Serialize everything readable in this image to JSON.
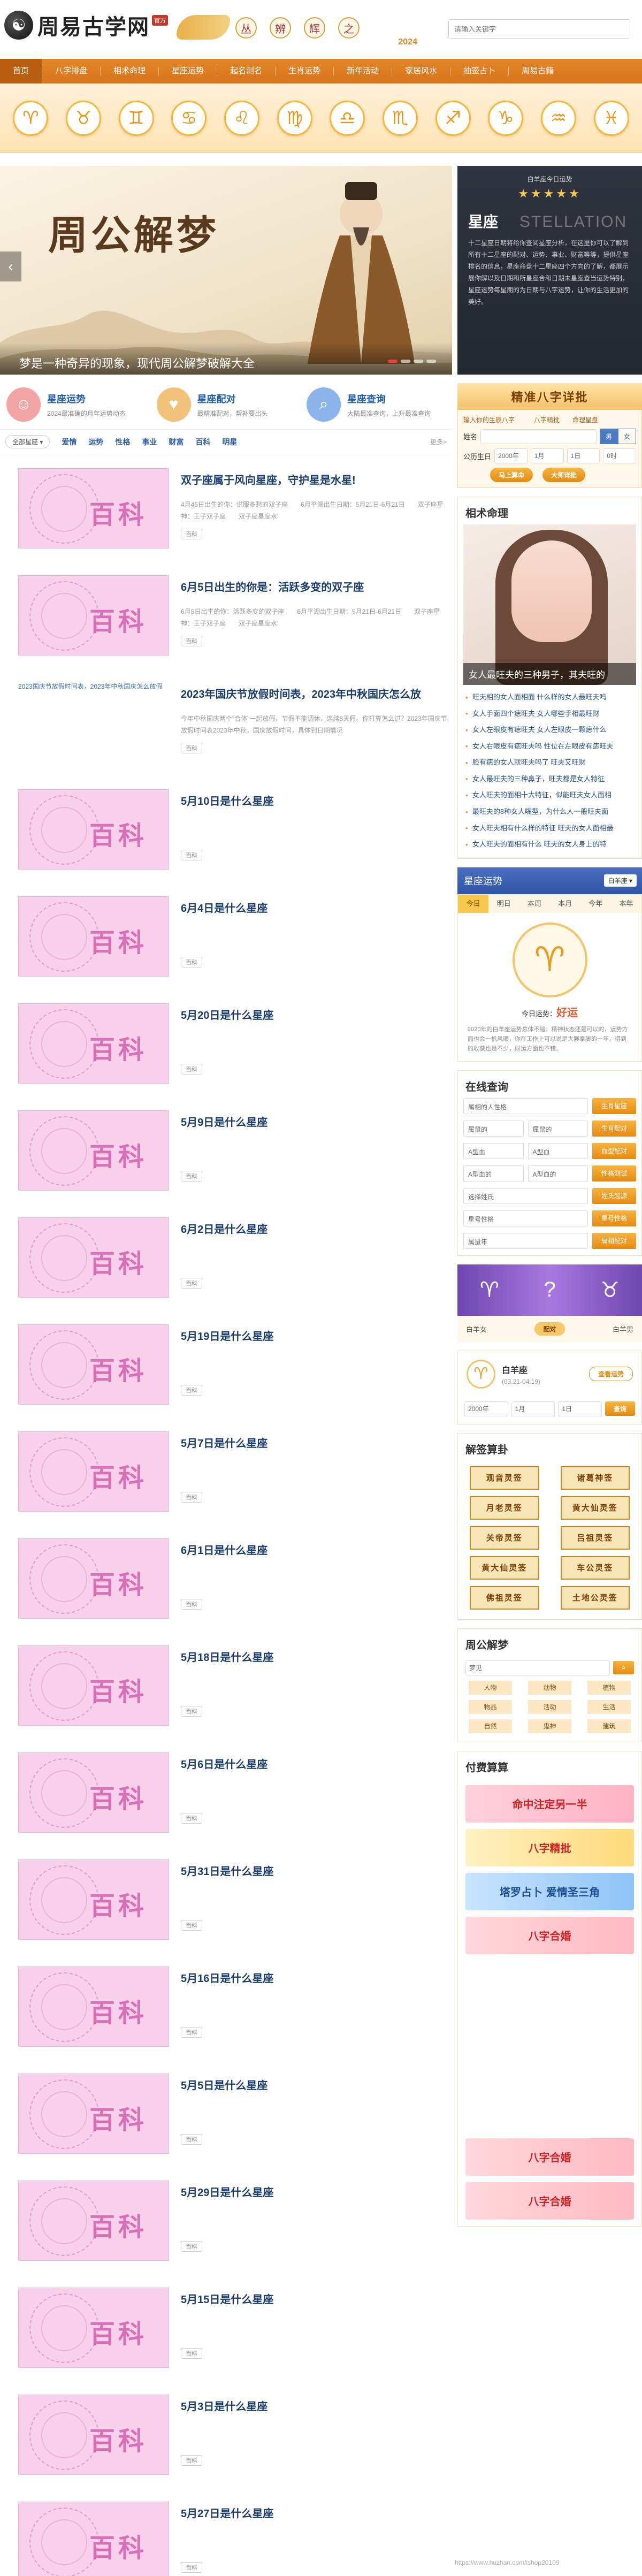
{
  "site": {
    "logo_glyph": "☯",
    "logo_text": "周易古学网",
    "logo_tag": "官方",
    "deco_chars": [
      "丛",
      "辨",
      "辉",
      "之"
    ],
    "deco_year": "2024",
    "search_placeholder": "请输入关键字"
  },
  "nav": {
    "items": [
      "首页",
      "八字排盘",
      "相术命理",
      "星座运势",
      "起名测名",
      "生肖运势",
      "新年活动",
      "家居风水",
      "抽签占卜",
      "周易古籍"
    ],
    "active_index": 0
  },
  "zodiac_icons": [
    "♈",
    "♉",
    "♊",
    "♋",
    "♌",
    "♍",
    "♎",
    "♏",
    "♐",
    "♑",
    "♒",
    "♓"
  ],
  "hero": {
    "title": "周公解梦",
    "caption": "梦是一种奇异的现象，现代周公解梦破解大全"
  },
  "quick": [
    {
      "icon": "star-person-icon",
      "title": "星座运势",
      "sub": "2024最准确的月年运势动态"
    },
    {
      "icon": "couple-icon",
      "title": "星座配对",
      "sub": "最精准配对，帮补要出头"
    },
    {
      "icon": "search-icon",
      "title": "星座查询",
      "sub": "大陆最准查询，上升最准查询"
    }
  ],
  "tabs": {
    "select_label": "全部星座",
    "items": [
      "爱情",
      "运势",
      "性格",
      "事业",
      "财富",
      "百科",
      "明星"
    ],
    "more": "更多>"
  },
  "articles": [
    {
      "title": "双子座属于风向星座，守护星是水星!",
      "desc": "4月45日出生的你：说服多愁的双子座　　6月平湖出生日期：5月21日-6月21日　　双子座星神：王子双子座　　双子座星座水",
      "tag": "百科",
      "image": "百科"
    },
    {
      "title": "6月5日出生的你是：活跃多变的双子座",
      "desc": "6月5日出生的你：活跃多变的双子座　　6月平湖出生日期：5月21日-6月21日　　双子座星神：王子双子座　　双子座星座水",
      "tag": "百科",
      "image": "百科"
    },
    {
      "title": "2023年国庆节放假时间表，2023年中秋国庆怎么放",
      "desc": "今年中秋国庆两个\"合体\"一起放假，节假不能调休，连续8天假。你打算怎么过？2023年国庆节放假时间表2023年中秋，国庆放假时间，具体到日期情况",
      "tag": "百科",
      "image_alt": "2023国庆节放假时间表，2023年中秋国庆怎么放假"
    },
    {
      "title": "5月10日是什么星座",
      "desc": "",
      "tag": "百科",
      "image": "百科"
    },
    {
      "title": "6月4日是什么星座",
      "desc": "",
      "tag": "百科",
      "image": "百科"
    },
    {
      "title": "5月20日是什么星座",
      "desc": "",
      "tag": "百科",
      "image": "百科"
    },
    {
      "title": "5月9日是什么星座",
      "desc": "",
      "tag": "百科",
      "image": "百科"
    },
    {
      "title": "6月2日是什么星座",
      "desc": "",
      "tag": "百科",
      "image": "百科"
    },
    {
      "title": "5月19日是什么星座",
      "desc": "",
      "tag": "百科",
      "image": "百科"
    },
    {
      "title": "5月7日是什么星座",
      "desc": "",
      "tag": "百科",
      "image": "百科"
    },
    {
      "title": "6月1日是什么星座",
      "desc": "",
      "tag": "百科",
      "image": "百科"
    },
    {
      "title": "5月18日是什么星座",
      "desc": "",
      "tag": "百科",
      "image": "百科"
    },
    {
      "title": "5月6日是什么星座",
      "desc": "",
      "tag": "百科",
      "image": "百科"
    },
    {
      "title": "5月31日是什么星座",
      "desc": "",
      "tag": "百科",
      "image": "百科"
    },
    {
      "title": "5月16日是什么星座",
      "desc": "",
      "tag": "百科",
      "image": "百科"
    },
    {
      "title": "5月5日是什么星座",
      "desc": "",
      "tag": "百科",
      "image": "百科"
    },
    {
      "title": "5月29日是什么星座",
      "desc": "",
      "tag": "百科",
      "image": "百科"
    },
    {
      "title": "5月15日是什么星座",
      "desc": "",
      "tag": "百科",
      "image": "百科"
    },
    {
      "title": "5月3日是什么星座",
      "desc": "",
      "tag": "百科",
      "image": "百科"
    },
    {
      "title": "5月27日是什么星座",
      "desc": "",
      "tag": "百科",
      "image": "百科"
    }
  ],
  "star_panel": {
    "head": "白羊座今日运势",
    "stars": "★★★★★",
    "title": "星座",
    "title_en": "STELLATION",
    "body": "十二星座日期将给你查阅星座分析，在这里你可以了解到所有十二星座的配对、运势、事业、财富等等，提供星座排名的信息，星座命盘十二星座四个方向的了解，都展示展你解以及日期和所星座合和日期未星座查当运势特别，星座运势每星期的为日期与八字运势，让你的生活更加的美好。"
  },
  "bazi": {
    "head": "精准八字详批",
    "sub": "输入你的生辰八字　　　八字精批　　命理星盘",
    "name_label": "姓名",
    "name_placeholder": "",
    "gender": [
      "男",
      "女"
    ],
    "gender_on": 0,
    "birth_label": "公历生日",
    "year": "2000年",
    "month": "1月",
    "day": "1日",
    "hour": "0时",
    "btn1": "马上算命",
    "btn2": "大师详批"
  },
  "fate": {
    "heading": "相术命理",
    "image_caption": "女人最旺夫的三种男子，其夫旺的",
    "items": [
      "旺夫相的女人面相面 什么样的女人最旺夫吗",
      "女人手面四个痣旺夫 女人哪些手相最旺财",
      "女人左眼皮有痣旺夫 女人左眼皮一颗痣什么",
      "女人右眼皮有痣旺夫吗 性位在左眼皮有痣旺夫",
      "脸有痣的女人就旺夫吗了 旺夫又旺财",
      "女人最旺夫的三种鼻子，旺夫都是女人特征",
      "女人旺夫的面相十大特征，似能旺夫女人面相",
      "最旺夫的8种女人嘴型，为什么人一般旺夫面",
      "女人旺夫相有什么样的特征 旺夫的女人面相最",
      "女人旺夫的面相有什么 旺夫的女人身上的特"
    ]
  },
  "fortune": {
    "head": "星座运势",
    "select": "白羊座",
    "tabs": [
      "今日",
      "明日",
      "本周",
      "本月",
      "今年",
      "本年"
    ],
    "tab_on": 0,
    "glyph": "♈",
    "luck_label": "今日运势：",
    "luck_value": "好运",
    "desc": "2020年的白羊座运势总体不错，精神状态还是可以的，运势方面也会一帆风顺，你在工作上可以说是大展拳脚的一年，得到的收获也是不少，财运方面也不错。"
  },
  "query": {
    "heading": "在线查询",
    "rows": [
      {
        "a": "属相的人性格",
        "b": "",
        "btn": "生肖星座"
      },
      {
        "a": "属鼠的",
        "b": "属鼠的",
        "btn": "生肖配对"
      },
      {
        "a": "A型血",
        "b": "A型血",
        "btn": "血型配对"
      },
      {
        "a": "A型血的",
        "b": "A型血的",
        "btn": "性格测试"
      },
      {
        "a": "选择姓氏",
        "b": "",
        "btn": "姓氏起源"
      },
      {
        "a": "星号性格",
        "b": "",
        "btn": "星号性格"
      },
      {
        "a": "属鼠年",
        "b": "",
        "btn": "属相配对"
      }
    ]
  },
  "match": {
    "glyphs": [
      "♈",
      "?",
      "♉"
    ],
    "left": "白羊女",
    "btn": "配对",
    "right": "白羊男"
  },
  "aries": {
    "glyph": "♈",
    "name": "白羊座",
    "date": "(03.21-04.19)",
    "btn": "查看运势",
    "year": "2000年",
    "month": "1月",
    "day": "1日",
    "query_btn": "查询"
  },
  "divination": {
    "heading": "解签算卦",
    "items": [
      "观音灵签",
      "诸葛神签",
      "月老灵签",
      "黄大仙灵签",
      "关帝灵签",
      "吕祖灵签",
      "黄大仙灵签",
      "车公灵签",
      "佛祖灵签",
      "土地公灵签"
    ]
  },
  "dream": {
    "heading": "周公解梦",
    "input": "梦见",
    "items": [
      "人物",
      "动物",
      "植物",
      "物品",
      "活动",
      "生活",
      "自然",
      "鬼神",
      "建筑"
    ]
  },
  "paid": {
    "heading": "付费算算",
    "ads": [
      "命中注定另一半",
      "八字精批",
      "塔罗占卜 爱情圣三角",
      "八字合婚",
      "八字合婚",
      "八字合婚"
    ]
  },
  "watermark": "https://www.huzhan.com/ishop20109"
}
